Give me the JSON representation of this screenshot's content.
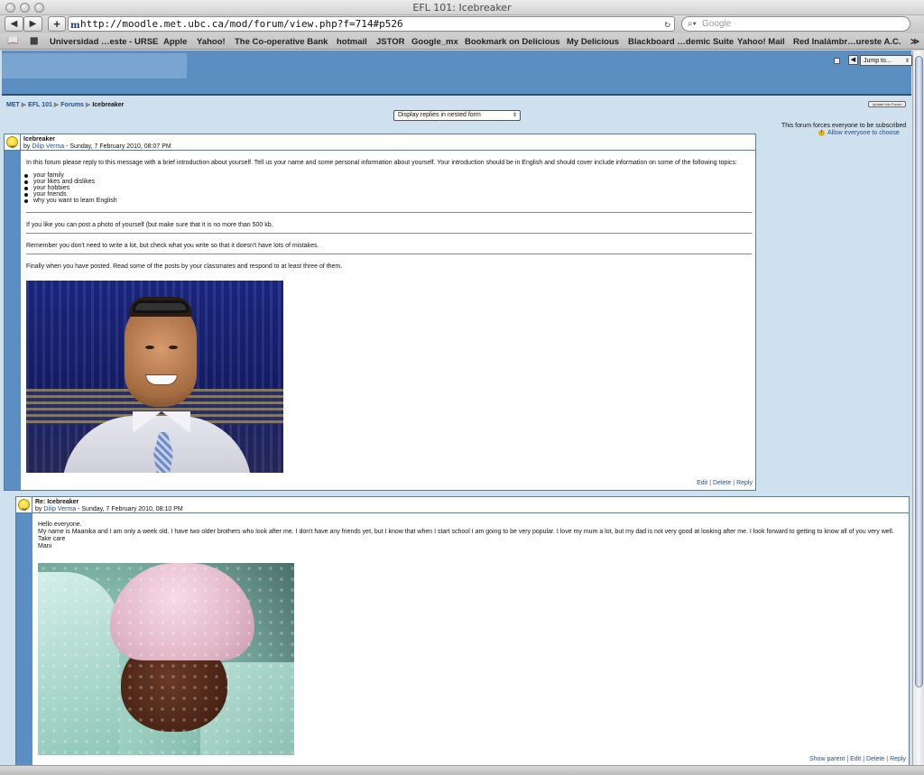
{
  "window": {
    "title": "EFL 101: Icebreaker"
  },
  "browser": {
    "back_label": "◀",
    "forward_label": "▶",
    "add_label": "+",
    "url": "http://moodle.met.ubc.ca/mod/forum/view.php?f=714#p526",
    "reload_label": "↻",
    "search_placeholder": "Google",
    "bookmarks": [
      "Universidad …este - URSE",
      "Apple",
      "Yahoo!",
      "The Co-operative Bank",
      "hotmail",
      "JSTOR",
      "Google_mx",
      "Bookmark on Delicious",
      "My Delicious",
      "Blackboard …demic Suite",
      "Yahoo! Mail",
      "Red Inalámbr…ureste A.C."
    ],
    "bookmarks_more": "≫"
  },
  "header": {
    "jump_label": "Jump to..."
  },
  "breadcrumb": {
    "items": [
      "MET",
      "EFL 101",
      "Forums",
      "Icebreaker"
    ],
    "sep": "▶"
  },
  "controls": {
    "update_button": "Update this Forum",
    "display_mode": "Display replies in nested form",
    "subscribe_note": "This forum forces everyone to be subscribed",
    "allow_choose": "Allow everyone to choose"
  },
  "posts": [
    {
      "subject": "Icebreaker",
      "by": "by",
      "author": "Dilip Verma",
      "date": " - Sunday, 7 February 2010, 08:07 PM",
      "intro": "In this forum please reply to this message with a brief introduction about yourself. Tell us your name and some personal information about yourself. Your introduction should be in English and should cover include information on some of the following topics:",
      "topics": [
        "your family",
        "your likes and dislikes",
        "your hobbies",
        "your friends",
        "why you want to learn English"
      ],
      "photo_note": "If you like you can post a photo of yourself (but make sure that it is no more than 500 kb.",
      "remember": "Remember you don't need to write a lot, but check what you write so that it doesn't have lots of mistakes.",
      "finally": "Finally when you have posted. Read some of the posts by your classmates and respond to at least three of them.",
      "links": {
        "edit": "Edit",
        "delete": "Delete",
        "reply": "Reply"
      }
    },
    {
      "subject": "Re: Icebreaker",
      "by": "by",
      "author": "Dilip Verma",
      "date": " - Sunday, 7 February 2010, 08:10 PM",
      "greeting": "Hello everyone.",
      "body": "My name is Maanika and I am only a week old. I have two older brothers who look after me. I don't have any friends yet, but I know that when I start school I am going to be very popular. I love my mum a lot, but my dad is not very good at looking after me. I look forward to getting to know all of you very well. Take care",
      "signature": "Mani",
      "links": {
        "show_parent": "Show parent",
        "edit": "Edit",
        "delete": "Delete",
        "reply": "Reply"
      }
    }
  ]
}
